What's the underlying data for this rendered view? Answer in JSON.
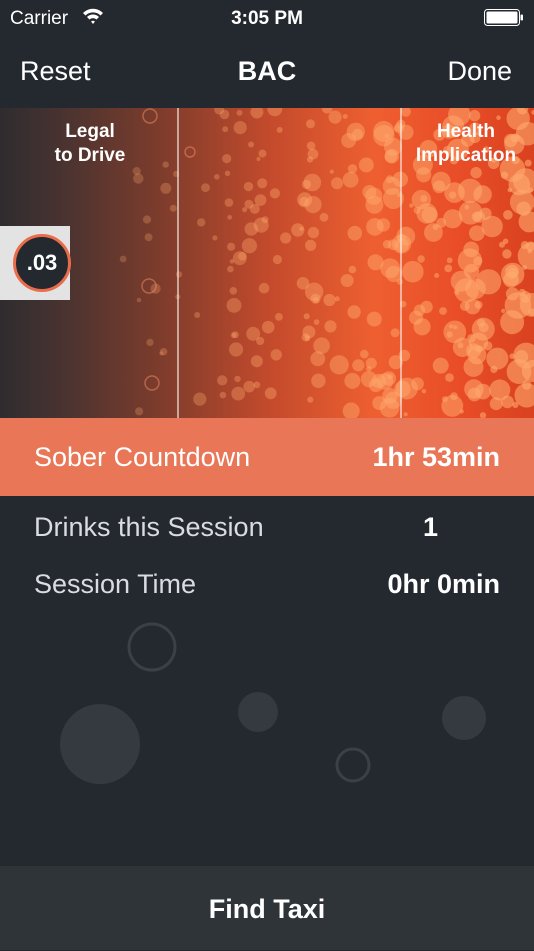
{
  "status_bar": {
    "carrier": "Carrier",
    "time": "3:05 PM"
  },
  "nav": {
    "left_label": "Reset",
    "title": "BAC",
    "right_label": "Done"
  },
  "gauge": {
    "legal_label": "Legal\nto Drive",
    "health_label": "Health\nImplication",
    "bac_value": ".03"
  },
  "countdown": {
    "label": "Sober Countdown",
    "value": "1hr 53min"
  },
  "session": {
    "drinks_label": "Drinks this Session",
    "drinks_value": "1",
    "time_label": "Session Time",
    "time_value": "0hr 0min"
  },
  "taxi": {
    "label": "Find Taxi"
  },
  "colors": {
    "accent": "#e97657",
    "background": "#24282f",
    "footer": "#2f3439"
  }
}
